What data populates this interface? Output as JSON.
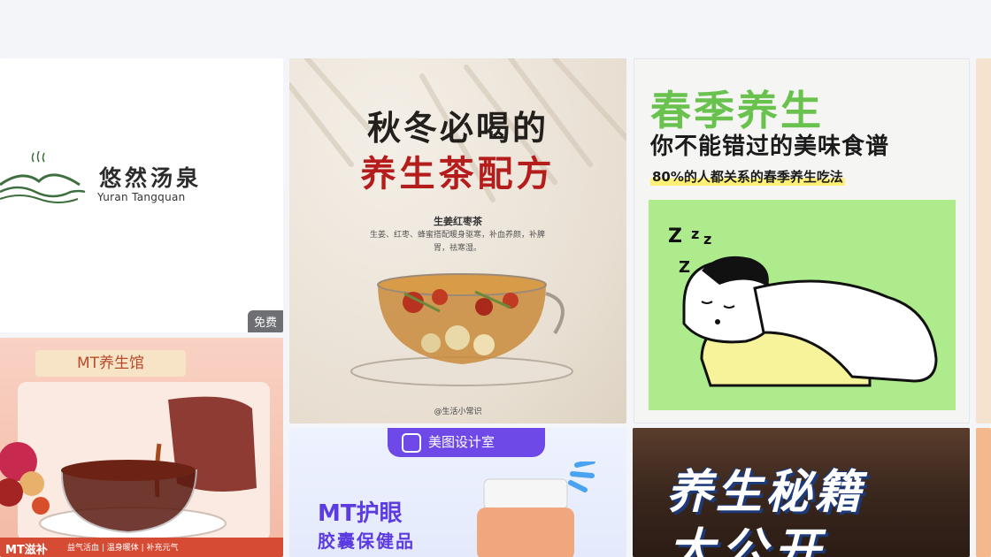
{
  "cards": {
    "logo": {
      "brand_cn": "悠然汤泉",
      "brand_en": "Yuran Tangquan",
      "badge": "免费"
    },
    "tea": {
      "title_line1": "秋冬必喝的",
      "title_line2": "养生茶配方",
      "recipe_name": "生姜红枣茶",
      "recipe_desc": "生姜、红枣、蜂蜜搭配暖身驱寒，补血养颜，补脾胃，祛寒湿。",
      "credit": "@生活小常识"
    },
    "spring": {
      "title": "春季养生",
      "subtitle": "你不能错过的美味食谱",
      "tagline": "80%的人都关系的春季养生吃法",
      "sleep_text": "Z z z"
    },
    "mt": {
      "tag": "MT养生馆",
      "bottom_main": "MT滋补",
      "bottom_tags": "益气活血 | 温身暖体 | 补充元气"
    },
    "design": {
      "brand": "美图设计室",
      "title_line1": "MT护眼",
      "title_line2": "胶囊保健品"
    },
    "secret": {
      "title_line1": "养生秘籍",
      "title_line2": "大公开"
    }
  },
  "colors": {
    "page_bg": "#f3f5f8",
    "tea_red": "#b51d1d",
    "spring_green": "#69c24e",
    "design_purple": "#6f49e8"
  }
}
